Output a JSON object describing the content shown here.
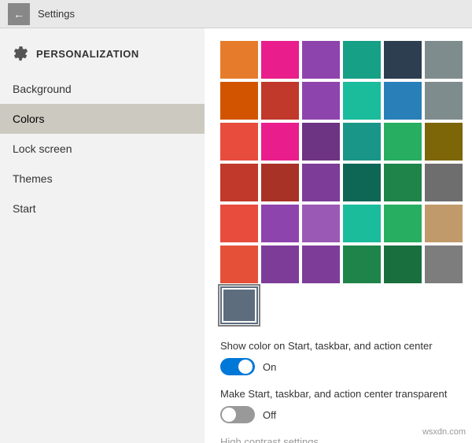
{
  "titleBar": {
    "title": "Settings",
    "backArrow": "←"
  },
  "sidebar": {
    "heading": "PERSONALIZATION",
    "items": [
      {
        "id": "background",
        "label": "Background",
        "active": false
      },
      {
        "id": "colors",
        "label": "Colors",
        "active": true
      },
      {
        "id": "lock-screen",
        "label": "Lock screen",
        "active": false
      },
      {
        "id": "themes",
        "label": "Themes",
        "active": false
      },
      {
        "id": "start",
        "label": "Start",
        "active": false
      }
    ]
  },
  "content": {
    "colors": [
      "#e67c2b",
      "#e91e8c",
      "#8e44ad",
      "#16a085",
      "#2c3e50",
      "#7f8c8d",
      "#d35400",
      "#c0392b",
      "#8e44ad",
      "#1abc9c",
      "#2980b9",
      "#7f8c8d",
      "#e74c3c",
      "#e91e8c",
      "#6c3483",
      "#1a9688",
      "#27ae60",
      "#7d6608",
      "#c0392b",
      "#a93226",
      "#7d3c98",
      "#0e6655",
      "#1e8449",
      "#6e6e6e",
      "#e74c3c",
      "#8e44ad",
      "#9b59b6",
      "#1abc9c",
      "#27ae60",
      "#c19a6b",
      "#e55039",
      "#7d3c98",
      "#7d3c98",
      "#1e8449",
      "#196f3d",
      "#7d7d7d",
      "#5d6d7e"
    ],
    "selectedColorIndex": 36,
    "showColorLabel": "Show color on Start, taskbar, and action center",
    "showColorToggle": {
      "state": "on",
      "label": "On"
    },
    "transparentLabel": "Make Start, taskbar, and action center transparent",
    "transparentToggle": {
      "state": "off",
      "label": "Off"
    },
    "highContrastLink": "High contrast settings"
  },
  "watermark": "wsxdn.com"
}
